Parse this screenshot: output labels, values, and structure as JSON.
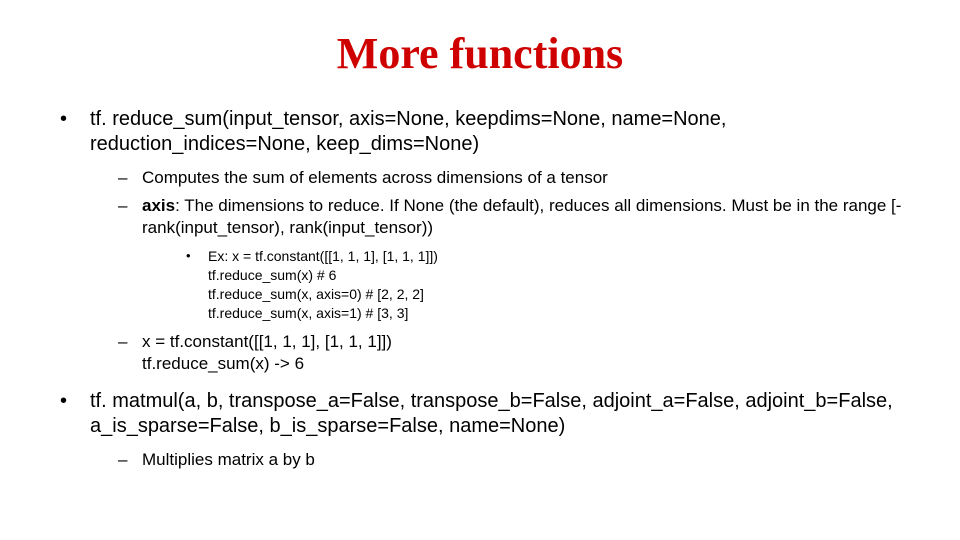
{
  "title": "More functions",
  "bullets": [
    {
      "sig": "tf. reduce_sum(input_tensor, axis=None, keepdims=None, name=None, reduction_indices=None, keep_dims=None)",
      "subs": [
        {
          "text": "Computes the sum of elements across dimensions of a tensor"
        },
        {
          "html": true,
          "prefix_bold": "axis",
          "rest": ": The dimensions to reduce. If None (the default), reduces all dimensions. Must be in the range [-rank(input_tensor), rank(input_tensor))"
        }
      ],
      "example": [
        "Ex: x = tf.constant([[1, 1, 1], [1, 1, 1]])",
        "tf.reduce_sum(x)  # 6",
        "tf.reduce_sum(x, axis=0)  # [2, 2, 2]",
        "tf.reduce_sum(x, axis=1)  # [3, 3]"
      ],
      "subs2": [
        {
          "line1": "x = tf.constant([[1, 1, 1], [1, 1, 1]])",
          "line2": "tf.reduce_sum(x) -> 6"
        }
      ]
    },
    {
      "sig": "tf. matmul(a, b, transpose_a=False, transpose_b=False, adjoint_a=False, adjoint_b=False, a_is_sparse=False, b_is_sparse=False, name=None)",
      "subs": [
        {
          "text": "Multiplies matrix a by b"
        }
      ]
    }
  ]
}
